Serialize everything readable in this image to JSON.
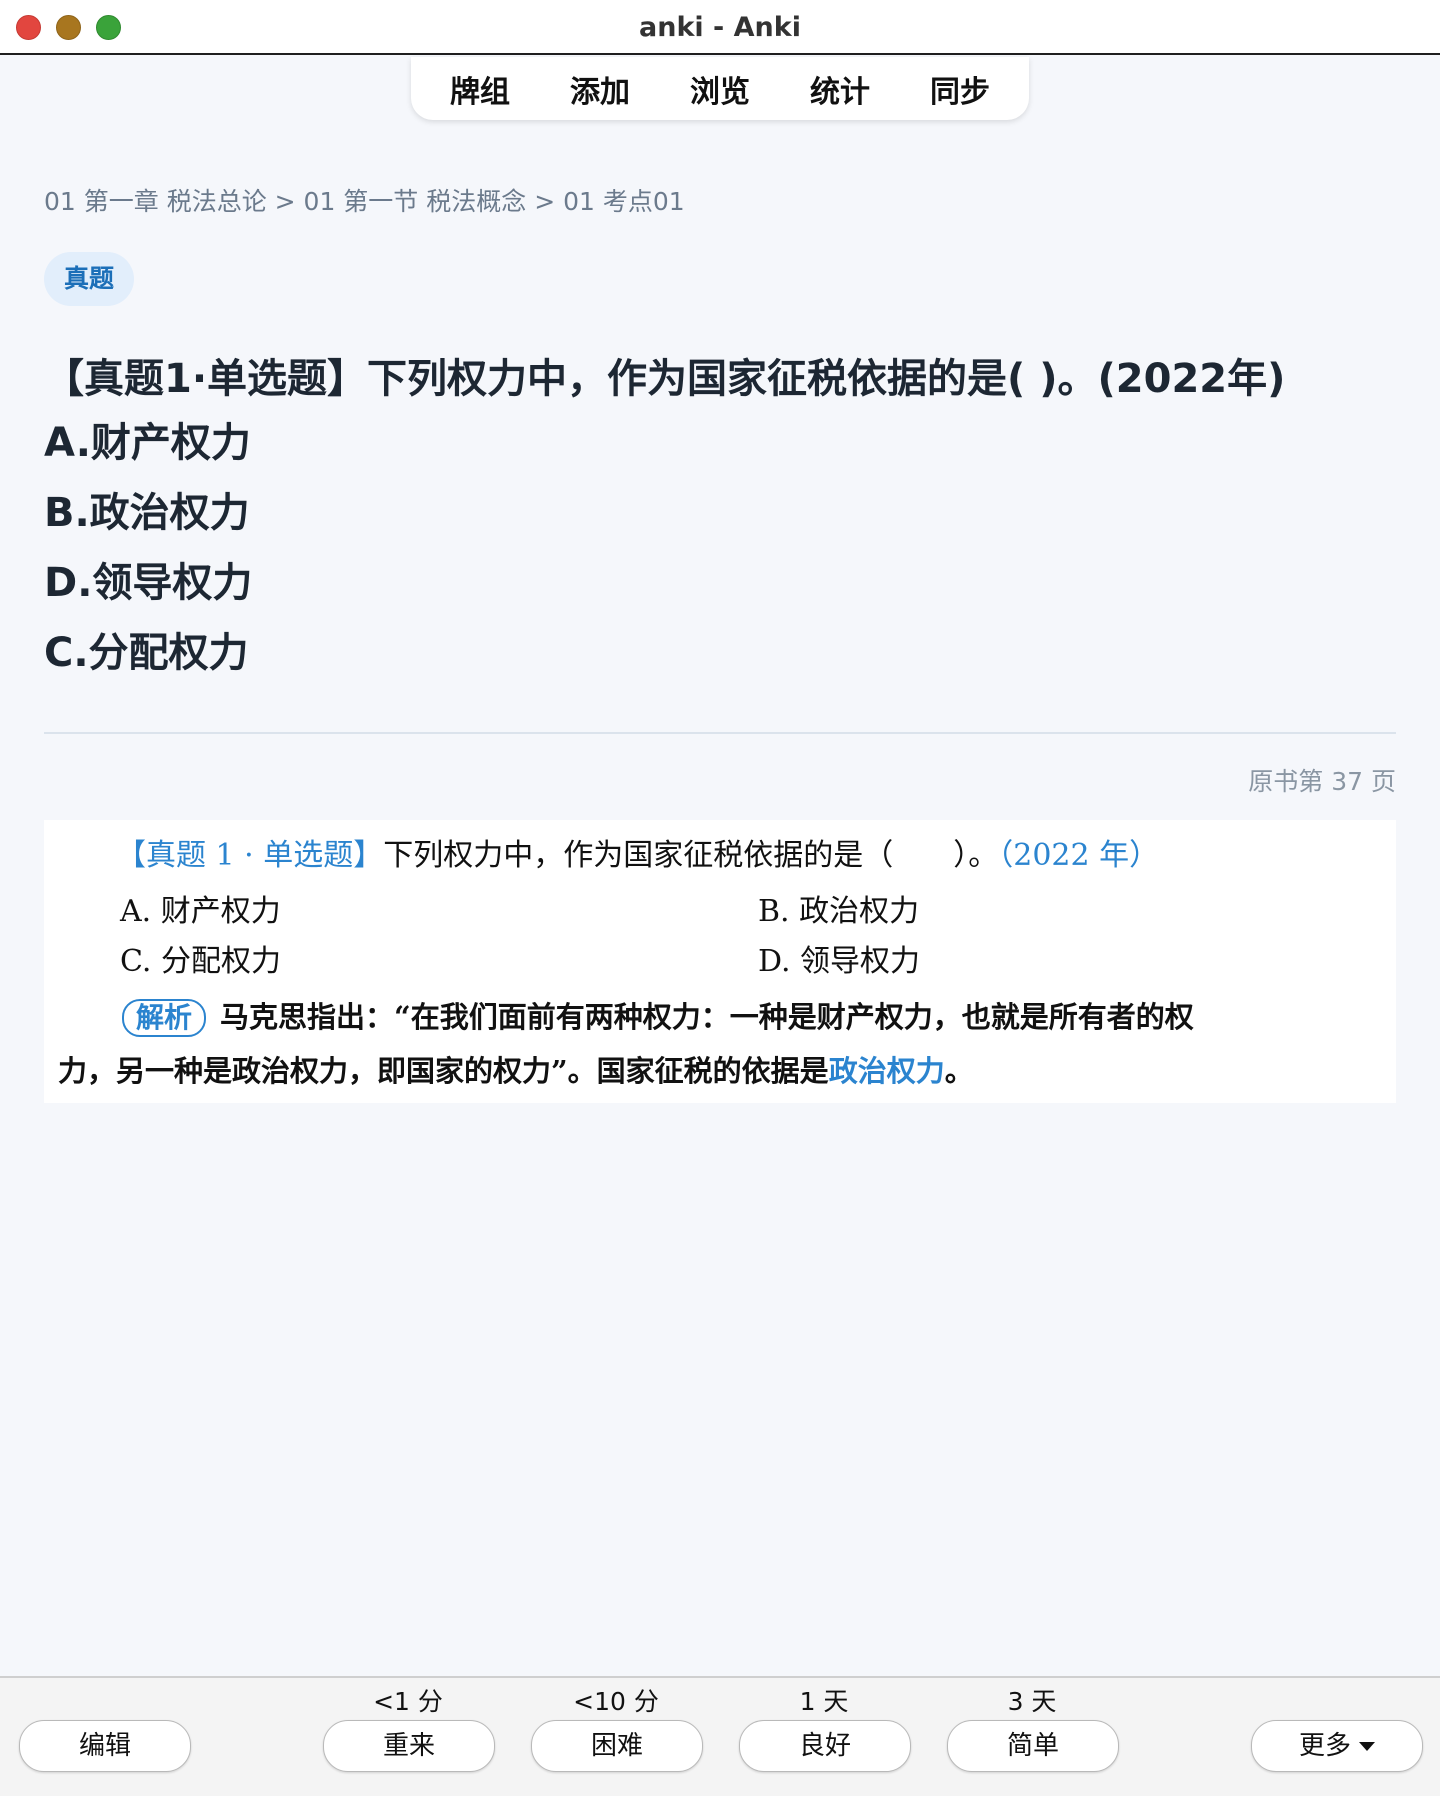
{
  "window": {
    "title": "anki - Anki"
  },
  "toolbar": {
    "items": [
      "牌组",
      "添加",
      "浏览",
      "统计",
      "同步"
    ]
  },
  "card": {
    "breadcrumb": "01 第一章 税法总论 > 01 第一节 税法概念 > 01 考点01",
    "tag": "真题",
    "question": "【真题1·单选题】下列权力中，作为国家征税依据的是( )。(2022年)",
    "options": [
      "A.财产权力",
      "B.政治权力",
      "D.领导权力",
      "C.分配权力"
    ],
    "page_ref": "原书第 37 页"
  },
  "book_excerpt": {
    "q_tag": "【真题 1 · 单选题】",
    "q_text": "下列权力中，作为国家征税依据的是（　　）。",
    "q_year": "（2022 年）",
    "options": [
      "A. 财产权力",
      "B. 政治权力",
      "C. 分配权力",
      "D. 领导权力"
    ],
    "analysis_label": "解析",
    "analysis_line1": "马克思指出：“在我们面前有两种权力：一种是财产权力，也就是所有者的权",
    "analysis_line2_prefix": "力，另一种是政治权力，即国家的权力”。国家征税的依据是",
    "analysis_answer": "政治权力",
    "analysis_end": "。"
  },
  "answer_bar": {
    "edit_label": "编辑",
    "intervals": [
      "<1 分",
      "<10 分",
      "1 天",
      "3 天"
    ],
    "buttons": [
      "重来",
      "困难",
      "良好",
      "简单"
    ],
    "more_label": "更多"
  }
}
